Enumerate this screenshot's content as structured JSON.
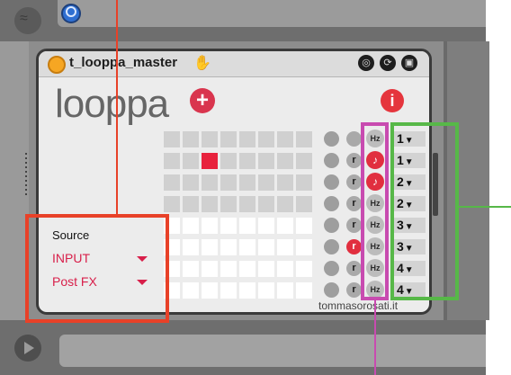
{
  "device": {
    "title": "t_looppa_master",
    "logo_text": "looppa",
    "plus_symbol": "+",
    "info_symbol": "i",
    "credit": "tommasorosati.it",
    "title_icons": [
      "headphones-icon",
      "refresh-icon",
      "save-icon"
    ]
  },
  "grid": {
    "columns": 8,
    "rows": 8,
    "white_rows": [
      4,
      5,
      6,
      7
    ],
    "active_cells": [
      [
        2,
        1
      ]
    ]
  },
  "tracks": [
    {
      "r_label": "",
      "r_active": false,
      "mode_label": "Hz",
      "mode_note": false,
      "selector": "1"
    },
    {
      "r_label": "r",
      "r_active": false,
      "mode_label": "♪",
      "mode_note": true,
      "selector": "1"
    },
    {
      "r_label": "r",
      "r_active": false,
      "mode_label": "♪",
      "mode_note": true,
      "selector": "2"
    },
    {
      "r_label": "r",
      "r_active": false,
      "mode_label": "Hz",
      "mode_note": false,
      "selector": "2"
    },
    {
      "r_label": "r",
      "r_active": false,
      "mode_label": "Hz",
      "mode_note": false,
      "selector": "3"
    },
    {
      "r_label": "r",
      "r_active": true,
      "mode_label": "Hz",
      "mode_note": false,
      "selector": "3"
    },
    {
      "r_label": "r",
      "r_active": false,
      "mode_label": "Hz",
      "mode_note": false,
      "selector": "4"
    },
    {
      "r_label": "r",
      "r_active": false,
      "mode_label": "Hz",
      "mode_note": false,
      "selector": "4"
    }
  ],
  "track_first_modes": {
    "row0_mode_visible": true
  },
  "source": {
    "label": "Source",
    "input_value": "INPUT",
    "tap_value": "Post FX"
  },
  "colors": {
    "accent_red": "#e12f3f",
    "annotation_red": "#e84128",
    "annotation_pink": "#c84bb0",
    "annotation_green": "#57b848",
    "source_text": "#d81f4a"
  }
}
